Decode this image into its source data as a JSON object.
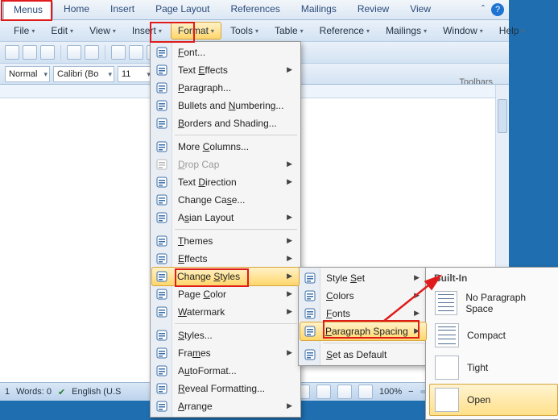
{
  "tabs": {
    "items": [
      {
        "label": "Menus"
      },
      {
        "label": "Home"
      },
      {
        "label": "Insert"
      },
      {
        "label": "Page Layout"
      },
      {
        "label": "References"
      },
      {
        "label": "Mailings"
      },
      {
        "label": "Review"
      },
      {
        "label": "View"
      }
    ]
  },
  "menubar": {
    "items": [
      {
        "label": "File"
      },
      {
        "label": "Edit"
      },
      {
        "label": "View"
      },
      {
        "label": "Insert"
      },
      {
        "label": "Format"
      },
      {
        "label": "Tools"
      },
      {
        "label": "Table"
      },
      {
        "label": "Reference"
      },
      {
        "label": "Mailings"
      },
      {
        "label": "Window"
      },
      {
        "label": "Help"
      }
    ],
    "open_index": 4
  },
  "formatbar": {
    "style": "Normal",
    "font": "Calibri (Bo",
    "size": "11"
  },
  "toolbars_label": "Toolbars",
  "format_menu": {
    "items": [
      {
        "label": "Font...",
        "u": 0
      },
      {
        "label": "Text Effects",
        "u": 5,
        "sub": true
      },
      {
        "label": "Paragraph...",
        "u": 0
      },
      {
        "label": "Bullets and Numbering...",
        "u": 12
      },
      {
        "label": "Borders and Shading...",
        "u": 0
      },
      {
        "sep": true
      },
      {
        "label": "More Columns...",
        "u": 5
      },
      {
        "label": "Drop Cap",
        "u": 0,
        "disabled": true,
        "sub": true
      },
      {
        "label": "Text Direction",
        "u": 5,
        "sub": true
      },
      {
        "label": "Change Case...",
        "u": 9
      },
      {
        "label": "Asian Layout",
        "u": 1,
        "sub": true
      },
      {
        "sep": true
      },
      {
        "label": "Themes",
        "u": 0,
        "sub": true
      },
      {
        "label": "Effects",
        "u": 0,
        "sub": true
      },
      {
        "label": "Change Styles",
        "u": 7,
        "sub": true,
        "hover": true
      },
      {
        "label": "Page Color",
        "u": 5,
        "sub": true
      },
      {
        "label": "Watermark",
        "u": 0,
        "sub": true
      },
      {
        "sep": true
      },
      {
        "label": "Styles...",
        "u": 0
      },
      {
        "label": "Frames",
        "u": 3,
        "sub": true
      },
      {
        "label": "AutoFormat...",
        "u": 1
      },
      {
        "label": "Reveal Formatting...",
        "u": 0
      },
      {
        "label": "Arrange",
        "u": 0,
        "sub": true
      }
    ]
  },
  "change_styles_menu": {
    "items": [
      {
        "label": "Style Set",
        "u": 6,
        "sub": true
      },
      {
        "label": "Colors",
        "u": 0,
        "sub": true
      },
      {
        "label": "Fonts",
        "u": 0,
        "sub": true
      },
      {
        "label": "Paragraph Spacing",
        "u": 0,
        "sub": true,
        "hover": true
      },
      {
        "sep": true
      },
      {
        "label": "Set as Default",
        "u": 0
      }
    ]
  },
  "builtin_panel": {
    "header": "Built-In",
    "items": [
      {
        "label": "No Paragraph Space",
        "gaps": [
          2,
          2,
          2,
          2,
          2
        ]
      },
      {
        "label": "Compact",
        "gaps": [
          2,
          4,
          2,
          4,
          2
        ]
      },
      {
        "label": "Tight",
        "gaps": [
          3,
          5,
          3,
          5,
          3
        ]
      },
      {
        "label": "Open",
        "gaps": [
          4,
          7,
          4,
          7
        ],
        "hover": true
      }
    ]
  },
  "status": {
    "page": "1",
    "words": "Words: 0",
    "lang": "English (U.S",
    "zoom": "100%"
  }
}
